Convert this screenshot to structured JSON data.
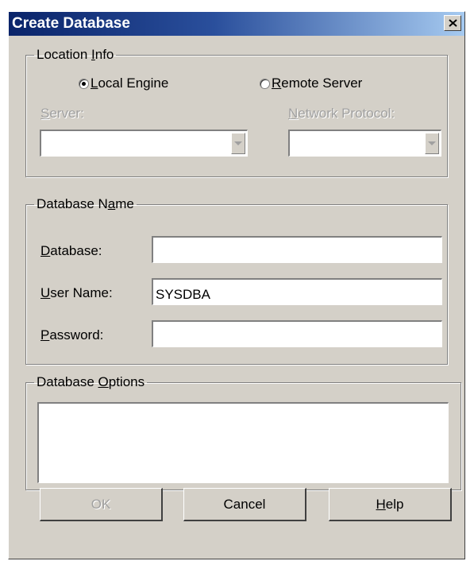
{
  "window": {
    "title": "Create Database",
    "close_icon": "close-icon"
  },
  "location_info": {
    "legend": "Location Info",
    "local_engine_label": "Local Engine",
    "local_engine_selected": true,
    "remote_server_label": "Remote Server",
    "remote_server_selected": false,
    "server_label": "Server:",
    "server_value": "",
    "network_protocol_label": "Network Protocol:",
    "network_protocol_value": ""
  },
  "database_name": {
    "legend": "Database Name",
    "database_label": "Database:",
    "database_value": "",
    "username_label": "User Name:",
    "username_value": "SYSDBA",
    "password_label": "Password:",
    "password_value": ""
  },
  "database_options": {
    "legend": "Database Options",
    "value": ""
  },
  "buttons": {
    "ok_label": "OK",
    "cancel_label": "Cancel",
    "help_label": "Help"
  },
  "colors": {
    "title_gradient_start": "#0a246a",
    "title_gradient_end": "#a6caf0",
    "dialog_face": "#d4d0c8",
    "disabled_text": "#a0a0a0"
  }
}
